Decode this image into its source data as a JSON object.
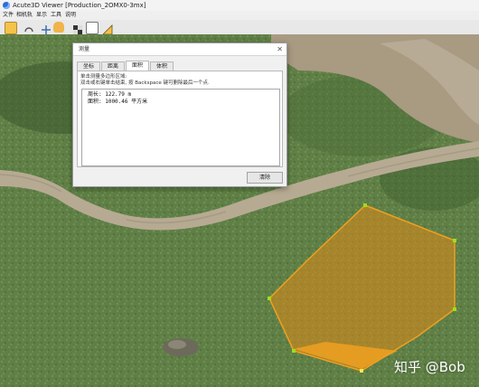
{
  "window": {
    "title": "Acute3D Viewer [Production_2OMX0-3mx]"
  },
  "menu": {
    "items": [
      "文件",
      "相机轨",
      "显示",
      "工具",
      "说明"
    ]
  },
  "toolbar": {
    "icons": [
      "open-folder-icon",
      "rotate-icon",
      "pan-icon",
      "hand-icon",
      "checker-icon",
      "fullscreen-icon",
      "measure-icon"
    ]
  },
  "dialog": {
    "title": "测量",
    "tabs": [
      "坐标",
      "距离",
      "面积",
      "体积"
    ],
    "active_tab": "面积",
    "hint_line1": "单击测量多边形区域:",
    "hint_line2": "双击或右键单击结束, 按 Backspace 键可删除最后一个点.",
    "result_perimeter": "周长: 122.79 m",
    "result_area": "面积: 1000.46 平方米",
    "clear_label": "清除"
  },
  "watermark": {
    "text": "知乎 @Bob"
  },
  "colors": {
    "polygon_fill": "#d98c1c",
    "polygon_edge": "#f0a020",
    "vertex_marker": "#9be01a"
  }
}
